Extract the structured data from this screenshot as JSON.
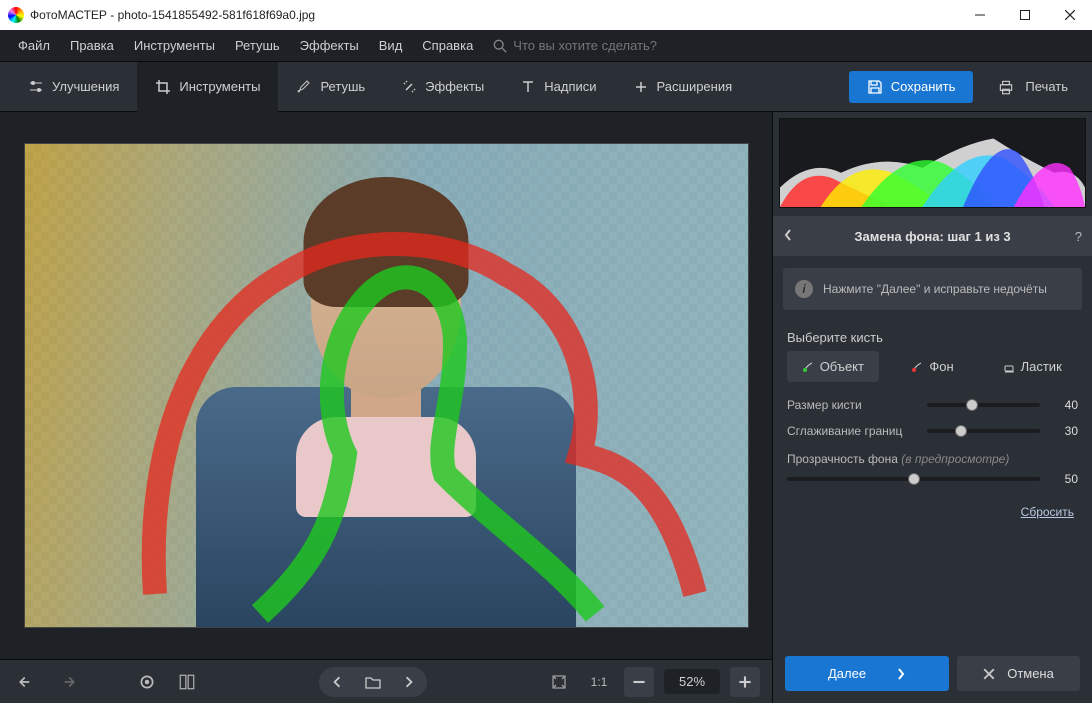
{
  "titlebar": {
    "app": "ФотоМАСТЕР",
    "file": "photo-1541855492-581f618f69a0.jpg"
  },
  "menu": {
    "file": "Файл",
    "edit": "Правка",
    "tools": "Инструменты",
    "retouch": "Ретушь",
    "effects": "Эффекты",
    "view": "Вид",
    "help": "Справка"
  },
  "search": {
    "placeholder": "Что вы хотите сделать?"
  },
  "tabs": {
    "enhance": "Улучшения",
    "tools": "Инструменты",
    "retouch": "Ретушь",
    "effects": "Эффекты",
    "text": "Надписи",
    "ext": "Расширения"
  },
  "actions": {
    "save": "Сохранить",
    "print": "Печать"
  },
  "zoom": {
    "value": "52%",
    "oneToOne": "1:1"
  },
  "panel": {
    "title": "Замена фона: шаг 1 из 3",
    "hint": "Нажмите \"Далее\" и исправьте недочёты",
    "brush_label": "Выберите кисть",
    "brushes": {
      "object": "Объект",
      "bg": "Фон",
      "eraser": "Ластик"
    },
    "size": {
      "label": "Размер кисти",
      "value": "40"
    },
    "smooth": {
      "label": "Сглаживание границ",
      "value": "30"
    },
    "opacity": {
      "label": "Прозрачность фона",
      "note": "(в предпросмотре)",
      "value": "50"
    },
    "reset": "Сбросить",
    "next": "Далее",
    "cancel": "Отмена"
  }
}
